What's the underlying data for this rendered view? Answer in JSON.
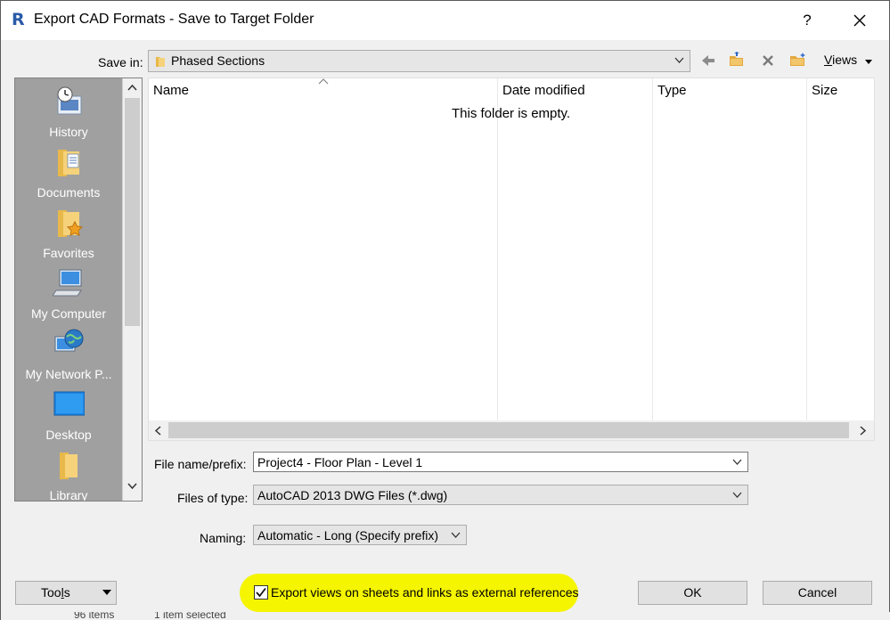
{
  "window": {
    "title": "Export CAD Formats - Save to Target Folder",
    "help_label": "?"
  },
  "save_in": {
    "label": "Save in:",
    "value": "Phased Sections"
  },
  "toolbar": {
    "views_label_prefix": "",
    "views_label_u": "V",
    "views_label_rest": "iews"
  },
  "places": {
    "items": [
      {
        "label": "History",
        "icon": "history-icon"
      },
      {
        "label": "Documents",
        "icon": "documents-folder-icon"
      },
      {
        "label": "Favorites",
        "icon": "favorites-folder-icon"
      },
      {
        "label": "My Computer",
        "icon": "computer-icon"
      },
      {
        "label": "My Network P...",
        "icon": "network-globe-icon"
      },
      {
        "label": "Desktop",
        "icon": "desktop-icon"
      },
      {
        "label": "Library",
        "icon": "library-folder-icon"
      }
    ]
  },
  "file_list": {
    "columns": [
      "Name",
      "Date modified",
      "Type",
      "Size"
    ],
    "empty_message": "This folder is empty."
  },
  "form": {
    "file_name_label": "File name/prefix:",
    "file_name_value": "Project4 - Floor Plan - Level 1",
    "files_of_type_label": "Files of type:",
    "files_of_type_value": "AutoCAD 2013 DWG Files  (*.dwg)",
    "naming_label": "Naming:",
    "naming_value": "Automatic - Long (Specify prefix)"
  },
  "bottom": {
    "tools_label_prefix": "Too",
    "tools_label_u": "l",
    "tools_label_rest": "s",
    "export_checkbox_label": "Export views on sheets and links as external references",
    "export_checkbox_checked": true,
    "ok_label": "OK",
    "cancel_label": "Cancel",
    "highlight_color": "#f5f500"
  },
  "status": {
    "items_text": "96 items",
    "selected_text": "1 item selected"
  }
}
